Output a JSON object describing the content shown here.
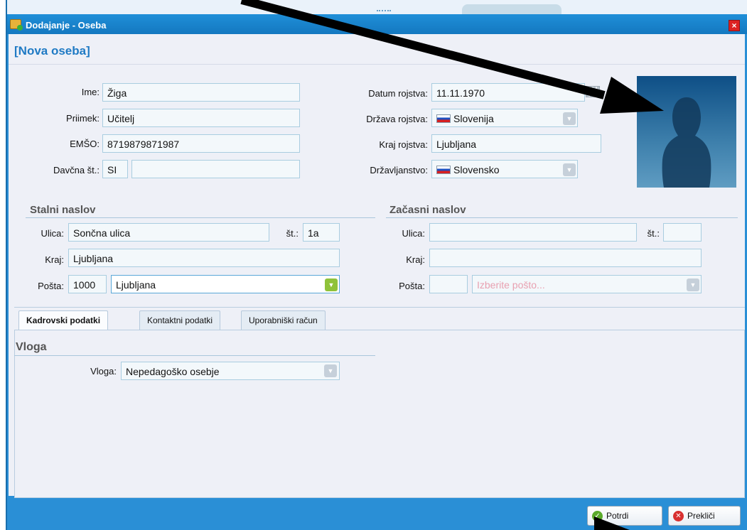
{
  "window": {
    "title": "Dodajanje - Oseba",
    "close_label": "×"
  },
  "heading": "[Nova oseba]",
  "personal": {
    "ime": {
      "label": "Ime:",
      "value": "Žiga"
    },
    "priimek": {
      "label": "Priimek:",
      "value": "Učitelj"
    },
    "emso": {
      "label": "EMŠO:",
      "value": "8719879871987"
    },
    "davcna": {
      "label": "Davčna št.:",
      "prefix": "SI",
      "value": ""
    },
    "datum": {
      "label": "Datum rojstva:",
      "value": "11.11.1970"
    },
    "drzava": {
      "label": "Država rojstva:",
      "value": "Slovenija"
    },
    "kraj": {
      "label": "Kraj rojstva:",
      "value": "Ljubljana"
    },
    "drzavljanstvo": {
      "label": "Državljanstvo:",
      "value": "Slovensko"
    }
  },
  "stalni": {
    "title": "Stalni naslov",
    "ulica_label": "Ulica:",
    "ulica": "Sončna ulica",
    "st_label": "št.:",
    "st": "1a",
    "kraj_label": "Kraj:",
    "kraj": "Ljubljana",
    "posta_label": "Pošta:",
    "posta_num": "1000",
    "posta_name": "Ljubljana"
  },
  "zacasni": {
    "title": "Začasni naslov",
    "ulica_label": "Ulica:",
    "ulica": "",
    "st_label": "št.:",
    "st": "",
    "kraj_label": "Kraj:",
    "kraj": "",
    "posta_label": "Pošta:",
    "posta_num": "",
    "posta_placeholder": "Izberite pošto..."
  },
  "tabs": [
    {
      "label": "Kadrovski podatki",
      "active": true
    },
    {
      "label": "Kontaktni podatki",
      "active": false
    },
    {
      "label": "Uporabniški račun",
      "active": false
    }
  ],
  "vloga": {
    "section": "Vloga",
    "label": "Vloga:",
    "value": "Nepedagoško osebje"
  },
  "buttons": {
    "confirm": "Potrdi",
    "cancel": "Prekliči"
  },
  "colors": {
    "titlebar": "#1f8fd8",
    "accent": "#1f7ac4",
    "confirm": "#5aaa2a",
    "cancel": "#d83030"
  }
}
